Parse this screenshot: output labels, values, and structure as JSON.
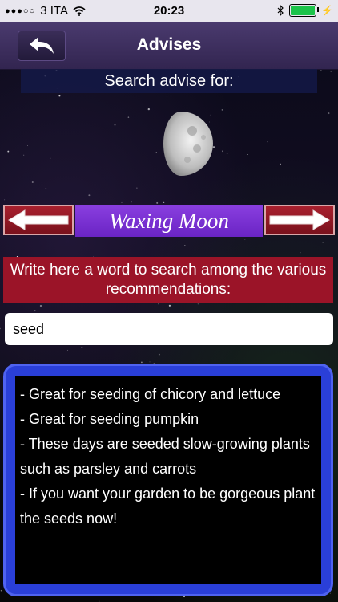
{
  "status_bar": {
    "carrier": "3 ITA",
    "time": "20:23"
  },
  "header": {
    "title": "Advises",
    "back_icon": "back-arrow-icon"
  },
  "search": {
    "heading": "Search advise for:",
    "moon_phase": "Waxing Moon",
    "prompt": "Write here a word to search among the various recommendations:",
    "input_value": "seed"
  },
  "results": [
    "- Great for seeding of chicory and lettuce",
    "- Great for seeding pumpkin",
    "- These days are  seeded slow-growing plants such as parsley and carrots",
    "- If you want your garden to be gorgeous plant the seeds now!"
  ],
  "colors": {
    "navbar": "#3e2f62",
    "phase_label": "#7a30d6",
    "prompt_box": "#9b1428",
    "results_frame": "#2a3fd8",
    "arrow_buttons": "#a8202e"
  }
}
